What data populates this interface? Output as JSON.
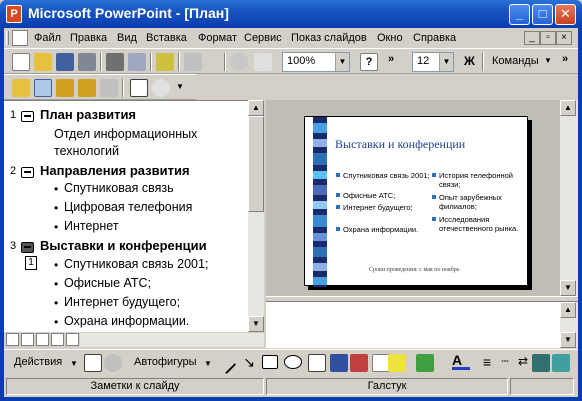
{
  "window": {
    "title": "Microsoft PowerPoint - [План]",
    "app_letter": "P"
  },
  "menu": {
    "items": [
      "Файл",
      "Правка",
      "Вид",
      "Вставка",
      "Формат",
      "Сервис",
      "Показ слайдов",
      "Окно",
      "Справка"
    ]
  },
  "toolbar": {
    "zoom": "100%",
    "font_size": "12",
    "bold": "Ж",
    "commands": "Команды",
    "more": "»"
  },
  "outline": {
    "slides": [
      {
        "num": "1",
        "title": "План развития",
        "body": [
          "Отдел информационных",
          "технологий"
        ]
      },
      {
        "num": "2",
        "title": "Направления развития",
        "bullets": [
          "Спутниковая связь",
          "Цифровая телефония",
          "Интернет"
        ]
      },
      {
        "num": "3",
        "title": "Выставки и конференции",
        "box": "1",
        "bullets": [
          "Спутниковая связь 2001;",
          "Офисные АТС;",
          "Интернет будущего;",
          "Охрана информации."
        ]
      }
    ]
  },
  "slide": {
    "title": "Выставки и конференции",
    "col1": [
      "Спутниковая связь 2001;",
      "Офисные АТС;",
      "Интернет будущего;",
      "Охрана информации."
    ],
    "col2": [
      "История телефонной связи;",
      "Опыт зарубежных филиалов;",
      "Исследования отечественного рынка."
    ],
    "footer": "Сроки проведения: с мая по ноябрь",
    "accent": "#2f6fb5"
  },
  "drawing": {
    "actions": "Действия",
    "autoshapes": "Автофигуры"
  },
  "status": {
    "notes": "Заметки к слайду",
    "design": "Галстук"
  }
}
